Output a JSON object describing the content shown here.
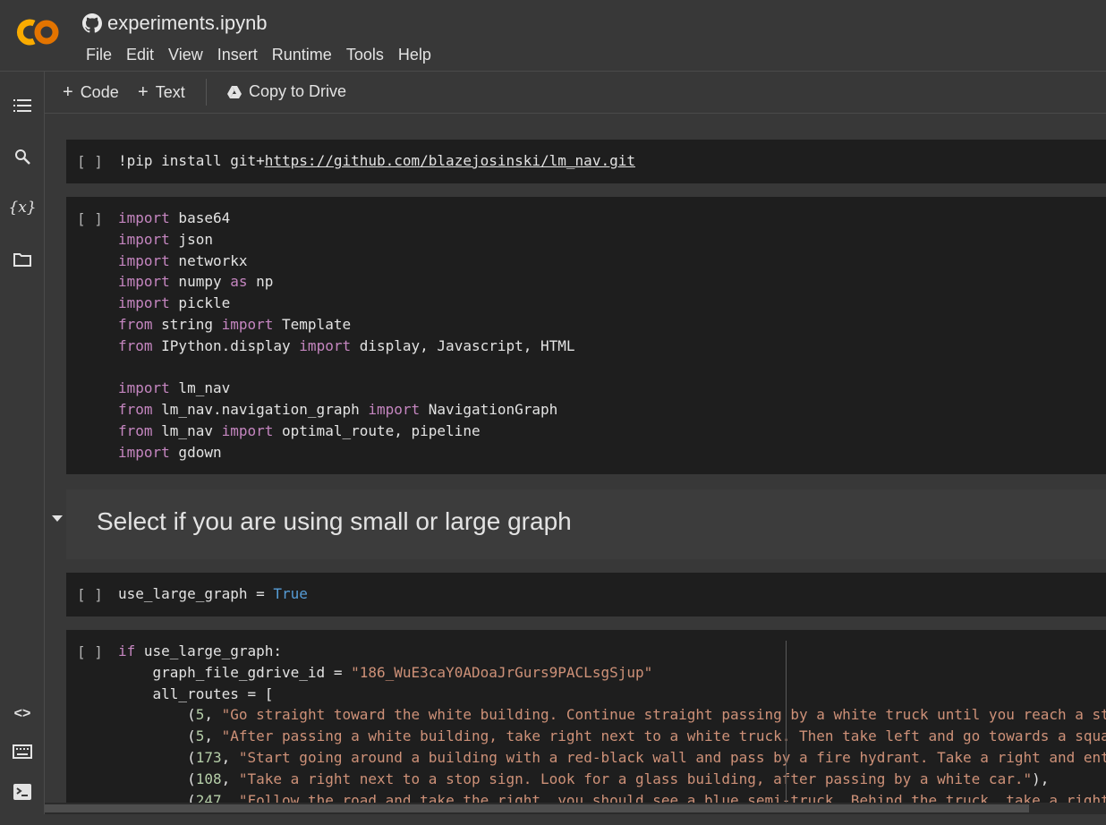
{
  "app": {
    "title": "experiments.ipynb"
  },
  "menu": [
    "File",
    "Edit",
    "View",
    "Insert",
    "Runtime",
    "Tools",
    "Help"
  ],
  "toolbar": {
    "code_label": "Code",
    "text_label": "Text",
    "drive_label": "Copy to Drive"
  },
  "cells": {
    "c1_bracket": "[ ]",
    "c1_cmd": "!pip install git+",
    "c1_url": "https://github.com/blazejosinski/lm_nav.git",
    "c2_bracket": "[ ]",
    "heading": "Select if you are using small or large graph",
    "c3_bracket": "[ ]",
    "c4_bracket": "[ ]"
  },
  "code2": [
    [
      "import",
      " base64"
    ],
    [
      "import",
      " json"
    ],
    [
      "import",
      " networkx"
    ],
    [
      "import",
      " numpy ",
      "as",
      " np"
    ],
    [
      "import",
      " pickle"
    ],
    [
      "from",
      " string ",
      "import",
      " Template"
    ],
    [
      "from",
      " IPython.display ",
      "import",
      " display, Javascript, HTML"
    ],
    [
      ""
    ],
    [
      "import",
      " lm_nav"
    ],
    [
      "from",
      " lm_nav.navigation_graph ",
      "import",
      " NavigationGraph"
    ],
    [
      "from",
      " lm_nav ",
      "import",
      " optimal_route, pipeline"
    ],
    [
      "import",
      " gdown"
    ]
  ],
  "code3": {
    "var": "use_large_graph = ",
    "value": "True"
  },
  "code4": {
    "l1_kw": "if",
    "l1_rest": " use_large_graph:",
    "l2_var": "    graph_file_gdrive_id = ",
    "l2_str": "\"186_WuE3caY0ADoaJrGurs9PACLsgSjup\"",
    "l3": "    all_routes = [",
    "routes": [
      [
        "5",
        "\"Go straight toward the white building. Continue straight passing by a white truck until you reach a st"
      ],
      [
        "5",
        "\"After passing a white building, take right next to a white truck. Then take left and go towards a squa"
      ],
      [
        "173",
        "\"Start going around a building with a red-black wall and pass by a fire hydrant. Take a right and ent"
      ],
      [
        "108",
        "\"Take a right next to a stop sign. Look for a glass building, after passing by a white car.\""
      ],
      [
        "247",
        "\"Follow the road and take the right, you should see a blue semi-truck. Behind the truck, take a right"
      ]
    ]
  }
}
